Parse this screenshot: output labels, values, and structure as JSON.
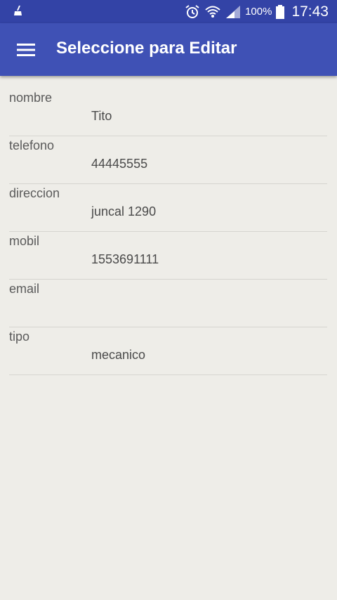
{
  "status_bar": {
    "left_icon": "cleaner-broom-icon",
    "icons": [
      "alarm-clock-icon",
      "wifi-icon",
      "cell-signal-icon",
      "battery-icon"
    ],
    "battery_percent": "100%",
    "time": "17:43",
    "color": "#3343a6"
  },
  "app_bar": {
    "menu_icon": "hamburger-menu-icon",
    "title": "Seleccione para Editar",
    "color": "#3f51b5"
  },
  "fields": [
    {
      "label": "nombre",
      "value": "Tito"
    },
    {
      "label": "telefono",
      "value": "44445555"
    },
    {
      "label": "direccion",
      "value": "juncal 1290"
    },
    {
      "label": "mobil",
      "value": "1553691111"
    },
    {
      "label": "email",
      "value": ""
    },
    {
      "label": "tipo",
      "value": "mecanico"
    }
  ],
  "colors": {
    "background": "#eeede8",
    "label_text": "#5a5a5a",
    "value_text": "#4a4a4a",
    "divider": "#d6d5d0"
  }
}
